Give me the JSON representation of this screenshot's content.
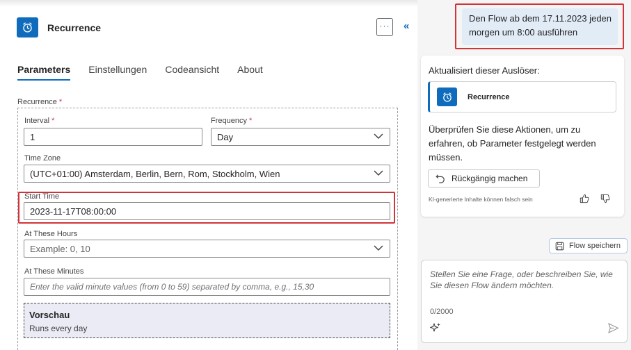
{
  "header": {
    "title": "Recurrence",
    "more_label": "···",
    "collapse_label": "«"
  },
  "tabs": [
    {
      "label": "Parameters",
      "active": true
    },
    {
      "label": "Einstellungen",
      "active": false
    },
    {
      "label": "Codeansicht",
      "active": false
    },
    {
      "label": "About",
      "active": false
    }
  ],
  "recurrence": {
    "section_label": "Recurrence",
    "required_mark": "*",
    "interval": {
      "label": "Interval",
      "required": "*",
      "value": "1"
    },
    "frequency": {
      "label": "Frequency",
      "required": "*",
      "value": "Day"
    },
    "time_zone": {
      "label": "Time Zone",
      "value": "(UTC+01:00) Amsterdam, Berlin, Bern, Rom, Stockholm, Wien"
    },
    "start_time": {
      "label": "Start Time",
      "value": "2023-11-17T08:00:00"
    },
    "hours": {
      "label": "At These Hours",
      "placeholder": "Example: 0, 10"
    },
    "minutes": {
      "label": "At These Minutes",
      "placeholder": "Enter the valid minute values (from 0 to 59) separated by comma, e.g., 15,30"
    },
    "preview": {
      "title": "Vorschau",
      "text": "Runs every day"
    }
  },
  "copilot": {
    "user_message": "Den Flow ab dem 17.11.2023 jeden morgen um 8:00 ausführen",
    "card": {
      "title": "Aktualisiert dieser Auslöser:",
      "trigger_name": "Recurrence",
      "description": "Überprüfen Sie diese Aktionen, um zu erfahren, ob Parameter festgelegt werden müssen.",
      "undo_label": "Rückgängig machen",
      "disclaimer": "KI-generierte Inhalte können falsch sein"
    },
    "save_label": "Flow speichern",
    "input": {
      "placeholder": "Stellen Sie eine Frage, oder beschreiben Sie, wie Sie diesen Flow ändern möchten.",
      "counter": "0/2000"
    }
  },
  "colors": {
    "accent": "#0f6cbd",
    "highlight": "#d13438",
    "user_bubble": "#e2ecf7",
    "panel_bg": "#f5f5f5"
  }
}
